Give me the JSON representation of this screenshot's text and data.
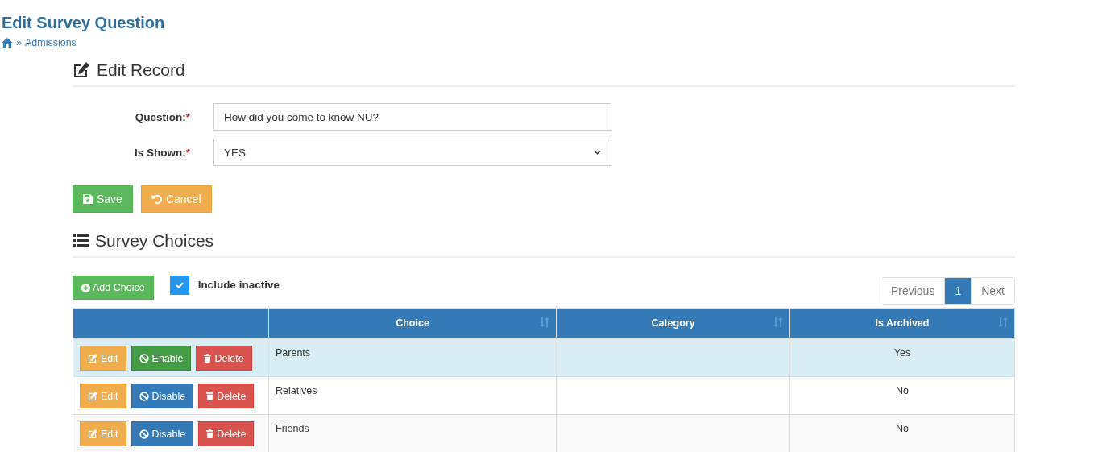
{
  "page_title": "Edit Survey Question",
  "breadcrumb": {
    "items": [
      {
        "separator": "»",
        "label": "Admissions"
      }
    ]
  },
  "required_marker": "*",
  "edit_section": {
    "title": "Edit Record",
    "fields": [
      {
        "kind": "text",
        "label": "Question:",
        "required": true,
        "value": "How did you come to know NU?"
      },
      {
        "kind": "select",
        "label": "Is Shown:",
        "required": true,
        "value": "YES"
      }
    ],
    "buttons": [
      {
        "kind": "save",
        "label": "Save"
      },
      {
        "kind": "cancel",
        "label": "Cancel"
      }
    ]
  },
  "choices_section": {
    "title": "Survey Choices",
    "add_button": "Add Choice",
    "include_inactive": {
      "label": "Include inactive",
      "checked": true
    },
    "pagination": [
      {
        "label": "Previous",
        "selected": false
      },
      {
        "label": "1",
        "selected": true
      },
      {
        "label": "Next",
        "selected": false
      }
    ],
    "table": {
      "columns": [
        {
          "label": "Choice"
        },
        {
          "label": "Category"
        },
        {
          "label": "Is Archived"
        }
      ],
      "rows": [
        {
          "selected": true,
          "edit": "Edit",
          "toggle": {
            "kind": "enable",
            "label": "Enable"
          },
          "delete": "Delete",
          "choice": "Parents",
          "is_archived": "Yes"
        },
        {
          "selected": false,
          "edit": "Edit",
          "toggle": {
            "kind": "disable",
            "label": "Disable"
          },
          "delete": "Delete",
          "choice": "Relatives",
          "is_archived": "No"
        },
        {
          "selected": false,
          "edit": "Edit",
          "toggle": {
            "kind": "disable",
            "label": "Disable"
          },
          "delete": "Delete",
          "choice": "Friends",
          "is_archived": "No"
        }
      ]
    }
  }
}
